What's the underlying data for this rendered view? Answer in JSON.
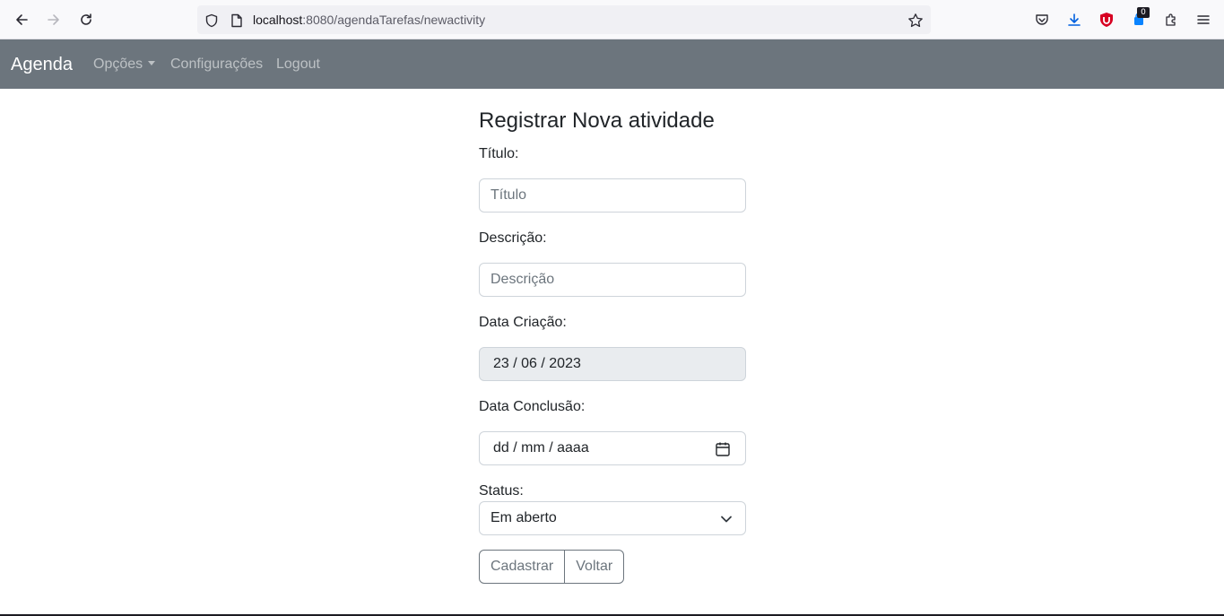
{
  "browser": {
    "url_host": "localhost",
    "url_rest": ":8080/agendaTarefas/newactivity",
    "extension_badge": "0"
  },
  "navbar": {
    "brand": "Agenda",
    "items": [
      {
        "label": "Opções"
      },
      {
        "label": "Configurações"
      },
      {
        "label": "Logout"
      }
    ]
  },
  "form": {
    "title": "Registrar Nova atividade",
    "titulo_label": "Título:",
    "titulo_placeholder": "Título",
    "descricao_label": "Descrição:",
    "descricao_placeholder": "Descrição",
    "data_criacao_label": "Data Criação:",
    "data_criacao_value": "23 / 06 / 2023",
    "data_conclusao_label": "Data Conclusão:",
    "data_conclusao_placeholder": "dd / mm / aaaa",
    "status_label": "Status:",
    "status_selected": "Em aberto",
    "submit_label": "Cadastrar",
    "back_label": "Voltar"
  },
  "colors": {
    "navbar_bg": "#6c757d",
    "disabled_input_bg": "#e9ecef"
  }
}
